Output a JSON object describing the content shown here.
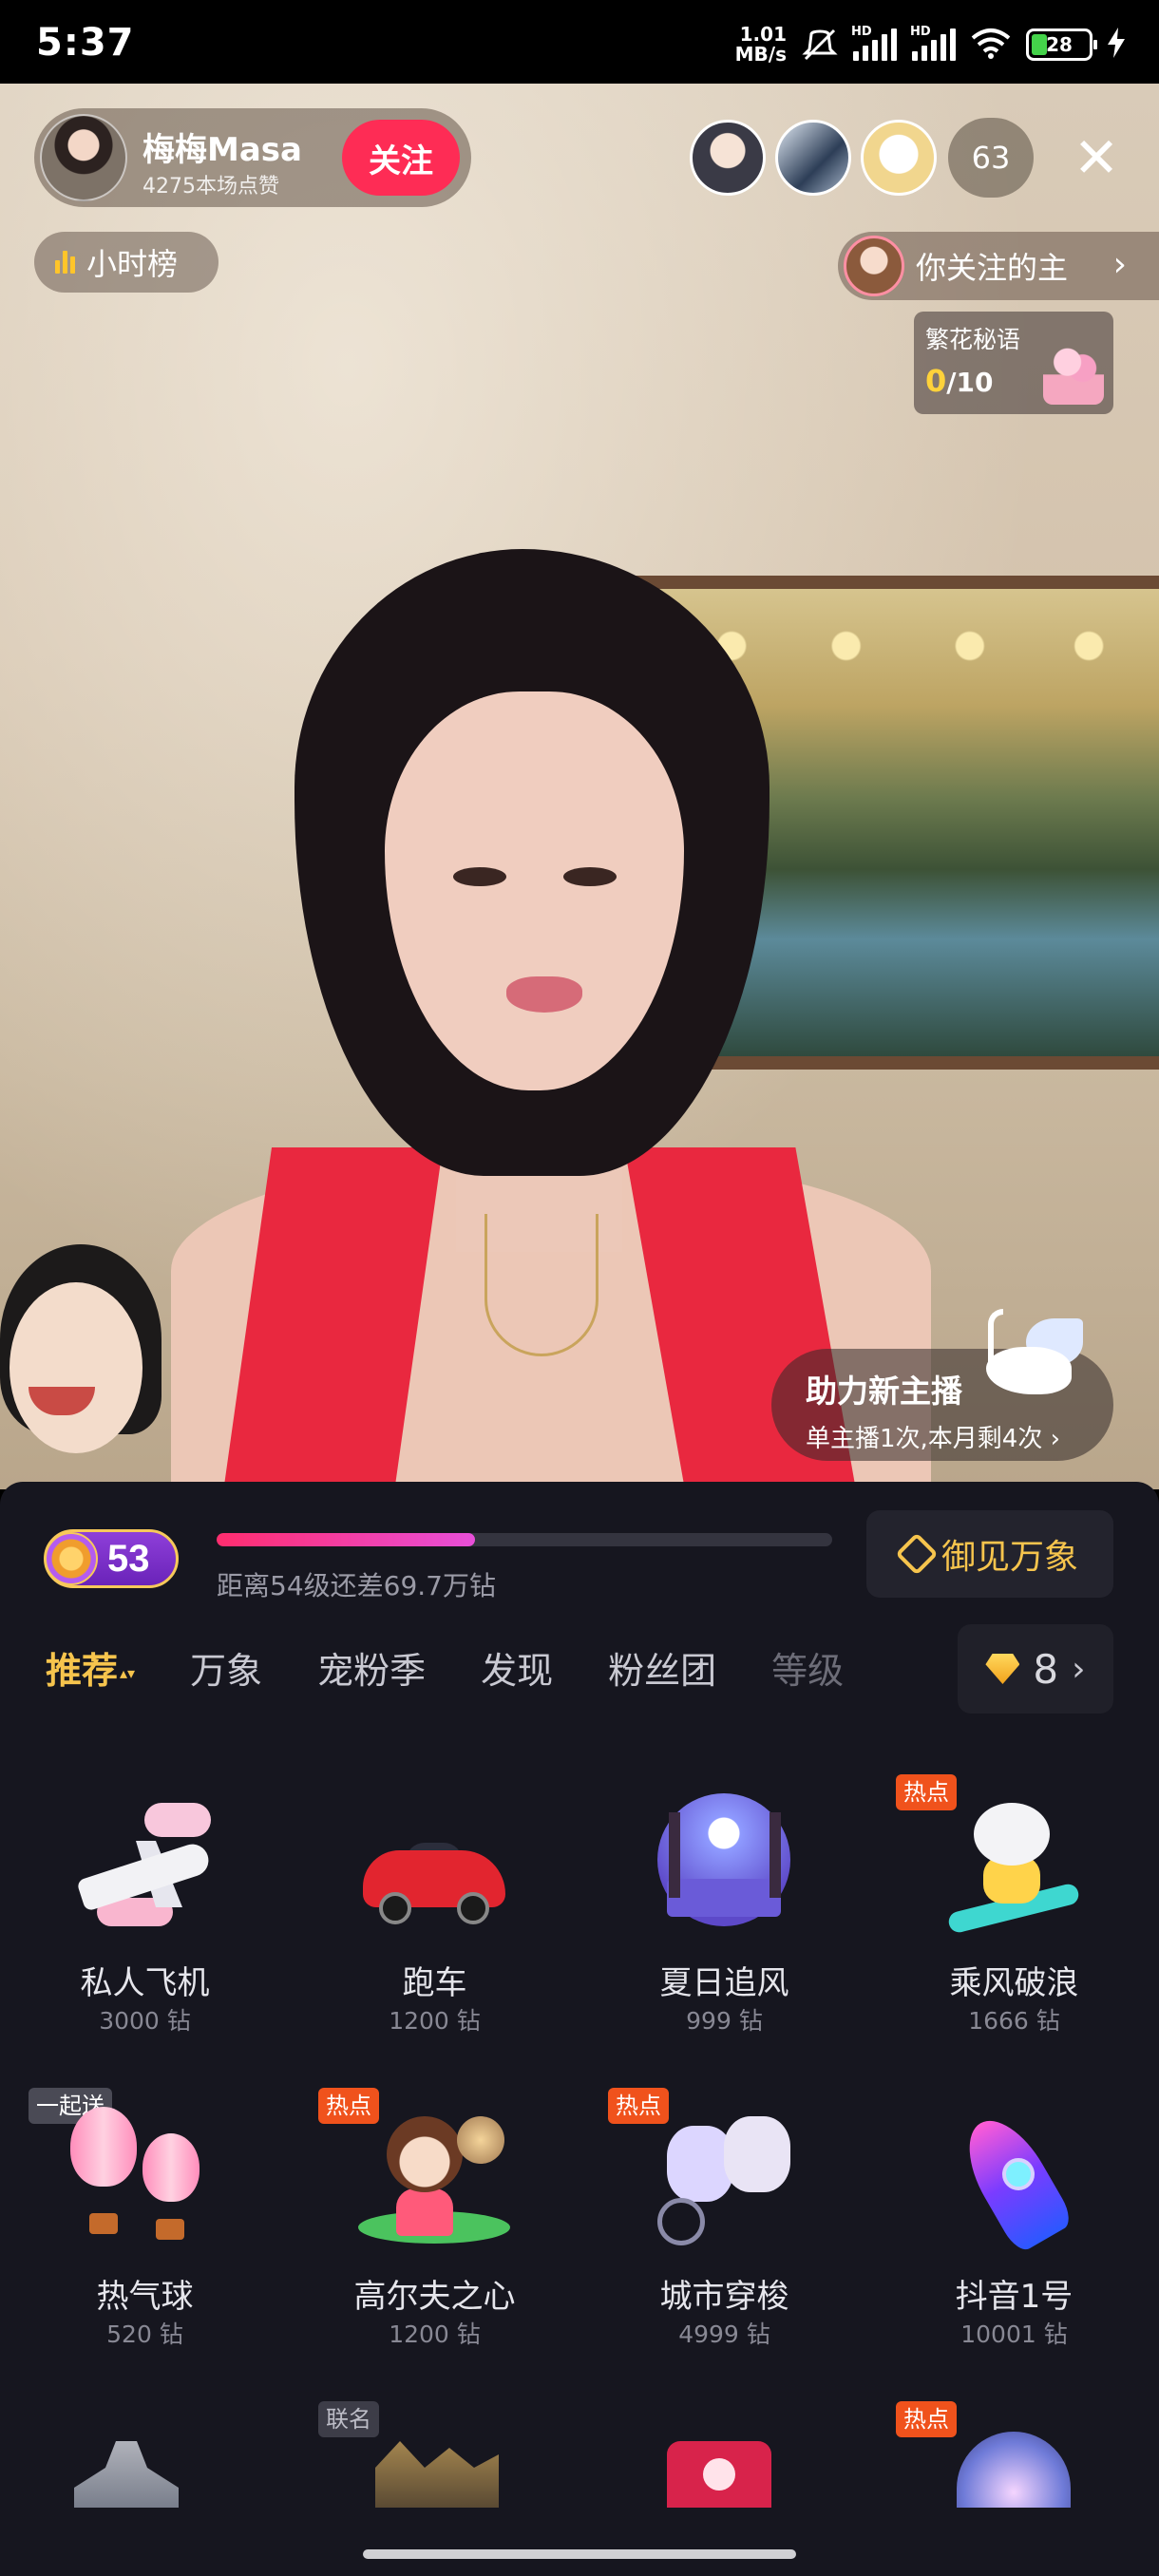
{
  "status_bar": {
    "time": "5:37",
    "net_speed_value": "1.01",
    "net_speed_unit": "MB/s",
    "hd1": "HD",
    "hd2": "HD",
    "battery": "28"
  },
  "live": {
    "anchor_name": "梅梅Masa",
    "anchor_likes": "4275本场点赞",
    "follow_label": "关注",
    "viewer_count": "63",
    "close_icon": "close-icon",
    "hour_rank_label": "小时榜",
    "follow_tip": "你关注的主",
    "flower_title": "繁花秘语",
    "flower_current": "0",
    "flower_total": "/10",
    "helper_title": "助力新主播",
    "helper_sub": "单主播1次,本月剩4次"
  },
  "panel": {
    "level": "53",
    "level_progress": 0.42,
    "level_text": "距离54级还差69.7万钻",
    "yujian_label": "御见万象",
    "tabs": [
      "推荐",
      "万象",
      "宠粉季",
      "发现",
      "粉丝团",
      "等级"
    ],
    "active_tab": "推荐",
    "coin_balance": "8",
    "gifts": [
      {
        "name": "私人飞机",
        "price": "3000 钻",
        "tag": ""
      },
      {
        "name": "跑车",
        "price": "1200 钻",
        "tag": ""
      },
      {
        "name": "夏日追风",
        "price": "999 钻",
        "tag": ""
      },
      {
        "name": "乘风破浪",
        "price": "1666 钻",
        "tag": "热点"
      },
      {
        "name": "热气球",
        "price": "520 钻",
        "tag": "一起送"
      },
      {
        "name": "高尔夫之心",
        "price": "1200 钻",
        "tag": "热点"
      },
      {
        "name": "城市穿梭",
        "price": "4999 钻",
        "tag": "热点"
      },
      {
        "name": "抖音1号",
        "price": "10001 钻",
        "tag": ""
      }
    ],
    "partial_tags": [
      "",
      "联名",
      "",
      "热点"
    ]
  },
  "colors": {
    "follow": "#fe2c55",
    "accent_gold": "#f6c44d",
    "hot_tag": "#f0521c",
    "panel_bg": "#16161f"
  }
}
